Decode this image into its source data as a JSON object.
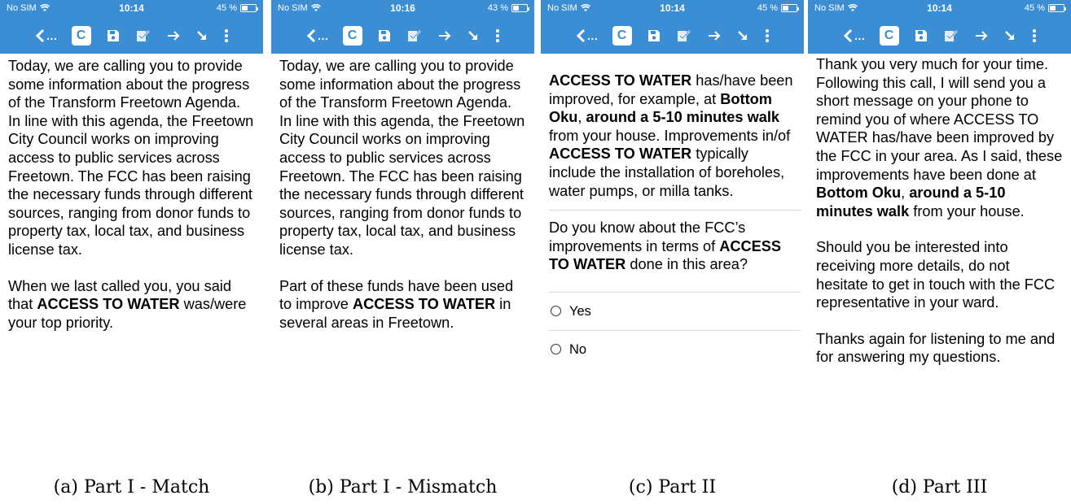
{
  "colors": {
    "bar": "#3b8ed3",
    "text": "#000000",
    "divider": "#d9d9d9"
  },
  "icons": {
    "back": "chevron-left-icon",
    "c": "c-letter-icon",
    "save": "floppy-disk-icon",
    "validate": "checked-form-icon",
    "forward": "arrow-right-icon",
    "collapse": "arrow-down-right-icon",
    "menu": "vertical-dots-icon"
  },
  "panels": [
    {
      "status": {
        "carrier": "No SIM",
        "time": "10:14",
        "battery": "45 %",
        "battery_level": 0.45
      },
      "caption": "(a) Part I - Match",
      "p1": "Today, we are calling you to provide some information about the progress of the Transform Freetown Agenda. In line with this agenda, the Freetown City Council works on improving access to public services across Freetown. The FCC has been raising the necessary funds through different sources, ranging from donor funds to property tax, local tax, and business license tax.",
      "p2_a": "When we last called you, you said that ",
      "p2_b": "ACCESS TO WATER",
      "p2_c": " was/were your top priority."
    },
    {
      "status": {
        "carrier": "No SIM",
        "time": "10:16",
        "battery": "43 %",
        "battery_level": 0.43
      },
      "caption": "(b) Part I - Mismatch",
      "p1": "Today, we are calling you to provide some information about the progress of the Transform Freetown Agenda. In line with this agenda, the Freetown City Council works on improving access to public services across Freetown. The FCC has been raising the necessary funds through different sources, ranging from donor funds to property tax, local tax, and business license tax.",
      "p2_a": "Part of these funds have been used to improve ",
      "p2_b": "ACCESS TO WATER",
      "p2_c": " in several areas in Freetown."
    },
    {
      "status": {
        "carrier": "No SIM",
        "time": "10:14",
        "battery": "45 %",
        "battery_level": 0.45
      },
      "caption": "(c) Part II",
      "p1_a": "ACCESS TO WATER",
      "p1_b": " has/have been improved, for example, at ",
      "p1_c": "Bottom Oku",
      "p1_d": ", ",
      "p1_e": "around a 5-10 minutes walk",
      "p1_f": " from your house. Improvements in/of ",
      "p1_g": "ACCESS TO WATER",
      "p1_h": " typically include the installation of boreholes, water pumps, or milla tanks.",
      "q_a": "Do you know about the FCC’s improvements in terms of ",
      "q_b": "ACCESS TO WATER",
      "q_c": " done in this area?",
      "options": [
        "Yes",
        "No"
      ]
    },
    {
      "status": {
        "carrier": "No SIM",
        "time": "10:14",
        "battery": "45 %",
        "battery_level": 0.45
      },
      "caption": "(d) Part III",
      "p1_a": "Thank you very much for your time. Following this call, I will send you a short message on your phone to remind you of where ACCESS TO WATER has/have been improved by the FCC in your area. As I said, these improvements have been done at ",
      "p1_b": "Bottom Oku",
      "p1_c": ", ",
      "p1_d": "around a 5-10 minutes walk",
      "p1_e": " from your house.",
      "p2": "Should you be interested into receiving more details, do not hesitate to get in touch with the FCC representative in your ward.",
      "p3": "Thanks again for listening to me and for answering my questions."
    }
  ]
}
